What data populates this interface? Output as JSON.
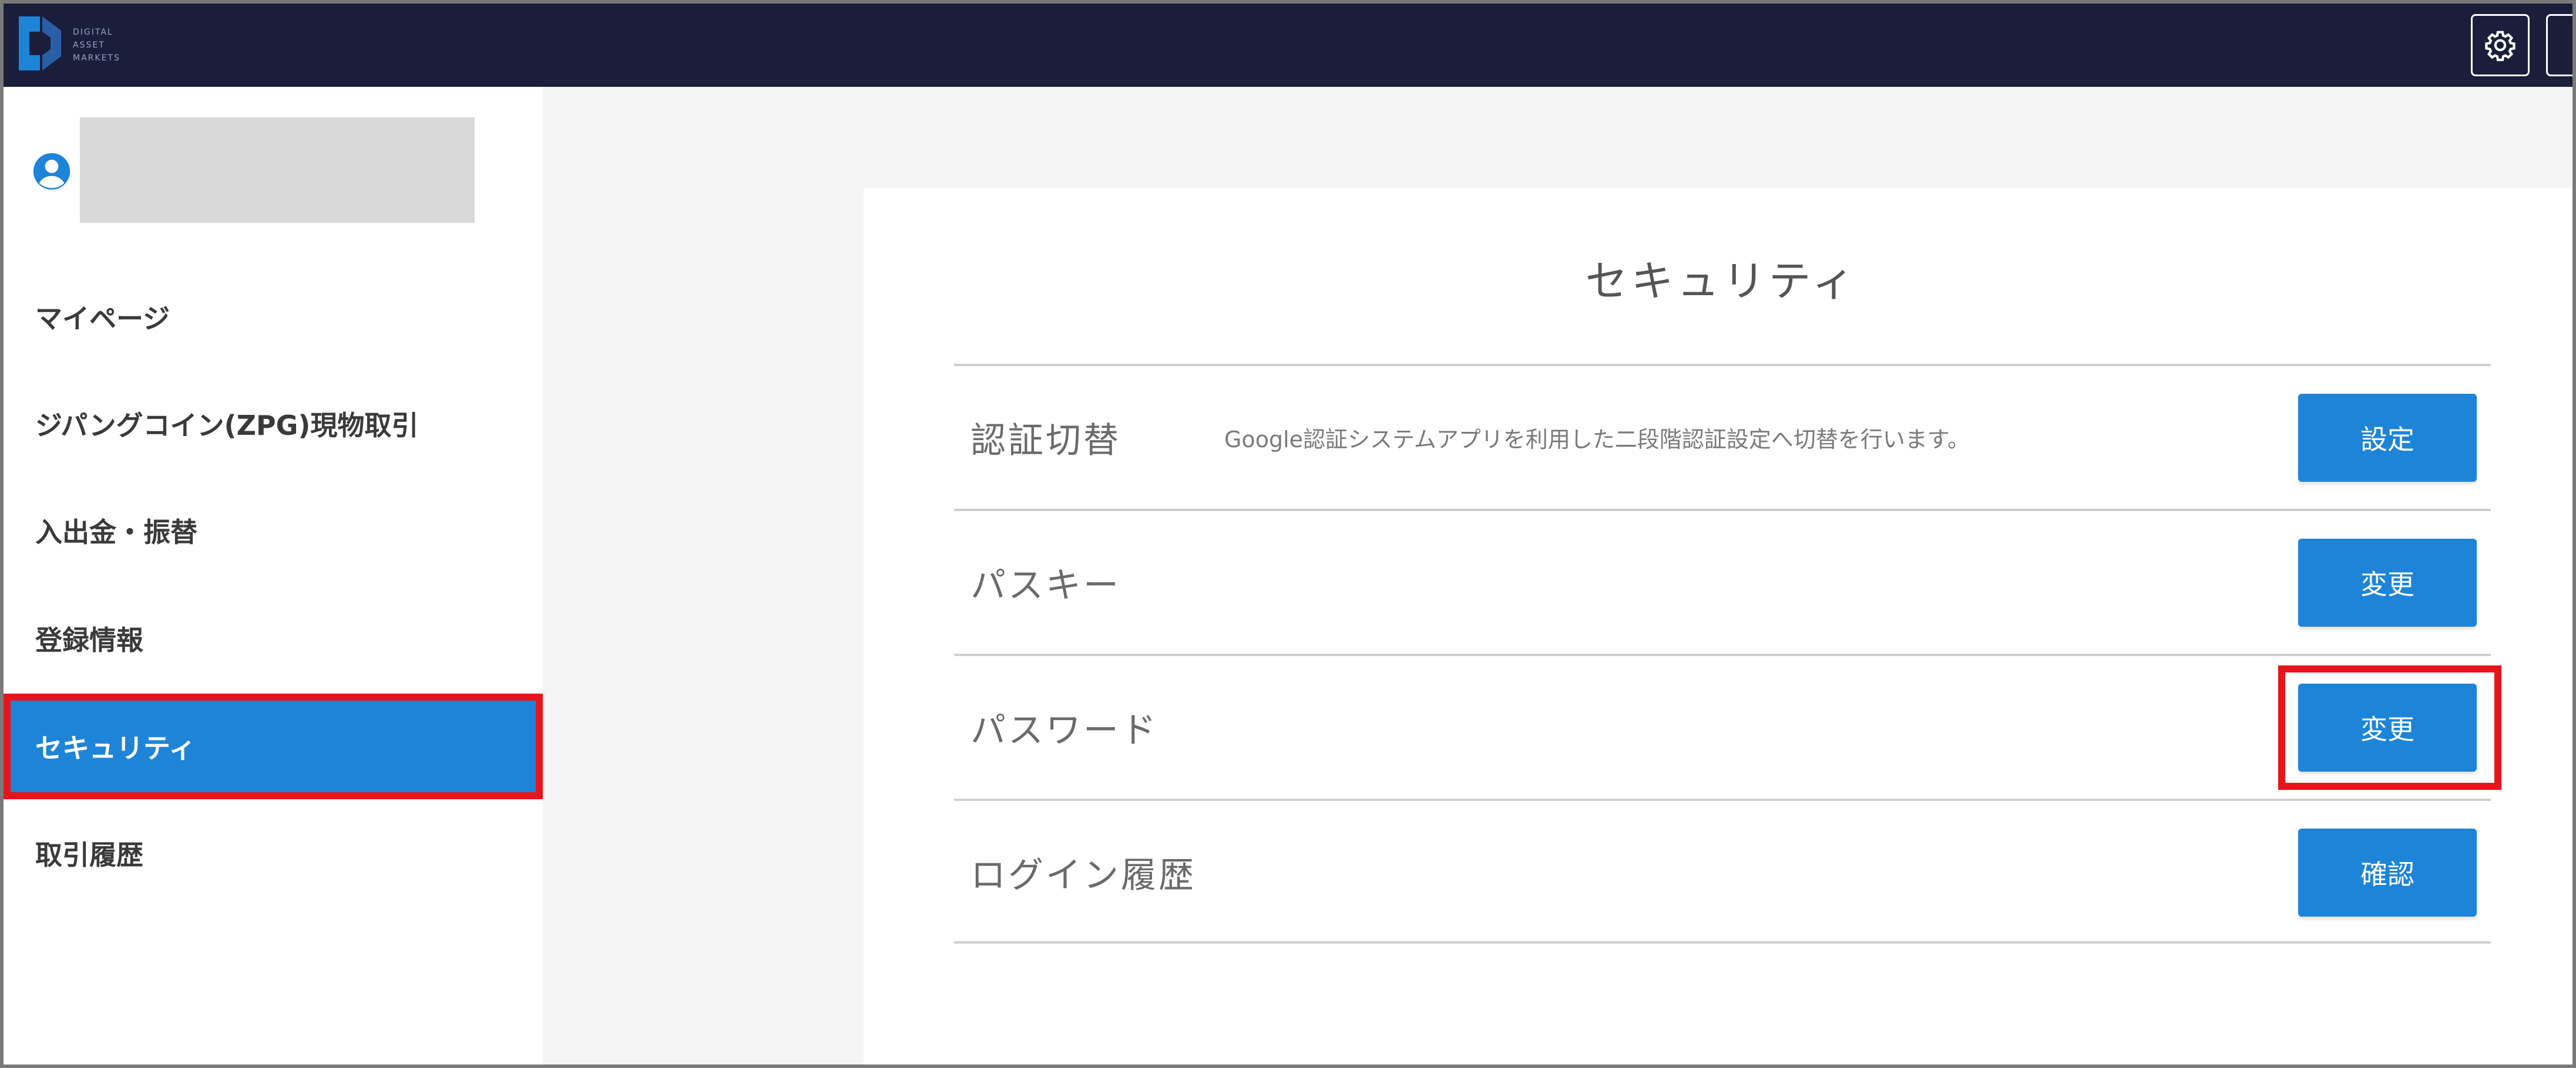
{
  "header": {
    "logo_text": [
      "DIGITAL",
      "ASSET",
      "MARKETS"
    ],
    "settings_icon": "gear-icon"
  },
  "sidebar": {
    "user_icon": "user-icon",
    "items": [
      {
        "label": "マイページ"
      },
      {
        "label": "ジパングコイン(ZPG)現物取引"
      },
      {
        "label": "入出金・振替"
      },
      {
        "label": "登録情報"
      },
      {
        "label": "セキュリティ",
        "active": true
      },
      {
        "label": "取引履歴"
      }
    ]
  },
  "main": {
    "title": "セキュリティ",
    "rows": [
      {
        "label": "認証切替",
        "description": "Google認証システムアプリを利用した二段階認証設定へ切替を行います。",
        "button": "設定"
      },
      {
        "label": "パスキー",
        "description": "",
        "button": "変更"
      },
      {
        "label": "パスワード",
        "description": "",
        "button": "変更"
      },
      {
        "label": "ログイン履歴",
        "description": "",
        "button": "確認"
      }
    ]
  },
  "colors": {
    "header_bg": "#1a1e3a",
    "accent": "#1e84d8",
    "highlight": "#e8141b"
  }
}
